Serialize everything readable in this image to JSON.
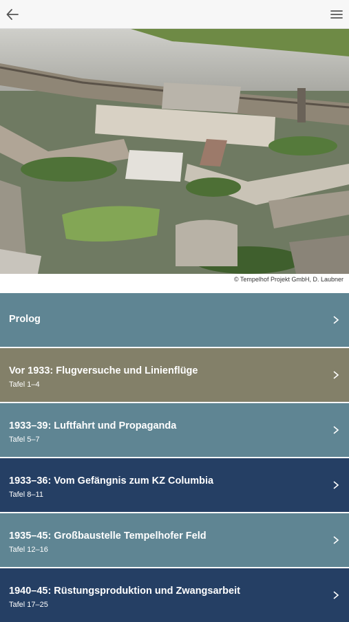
{
  "header": {
    "back_icon": "arrow-left-icon",
    "menu_icon": "hamburger-menu-icon"
  },
  "hero": {
    "credit": "© Tempelhof Projekt GmbH, D. Laubner"
  },
  "sections": [
    {
      "title": "Prolog",
      "subtitle": "",
      "color": "#5f8593"
    },
    {
      "title": "Vor 1933: Flugversuche und Linienflüge",
      "subtitle": "Tafel 1–4",
      "color": "#838069"
    },
    {
      "title": "1933–39: Luftfahrt und Propaganda",
      "subtitle": "Tafel 5–7",
      "color": "#5f8593"
    },
    {
      "title": "1933–36: Vom Gefängnis zum KZ Columbia",
      "subtitle": "Tafel 8–11",
      "color": "#253f64"
    },
    {
      "title": "1935–45: Großbaustelle Tempelhofer Feld",
      "subtitle": "Tafel 12–16",
      "color": "#5f8593"
    },
    {
      "title": "1940–45: Rüstungsproduktion und Zwangsarbeit",
      "subtitle": "Tafel 17–25",
      "color": "#253f64"
    }
  ]
}
